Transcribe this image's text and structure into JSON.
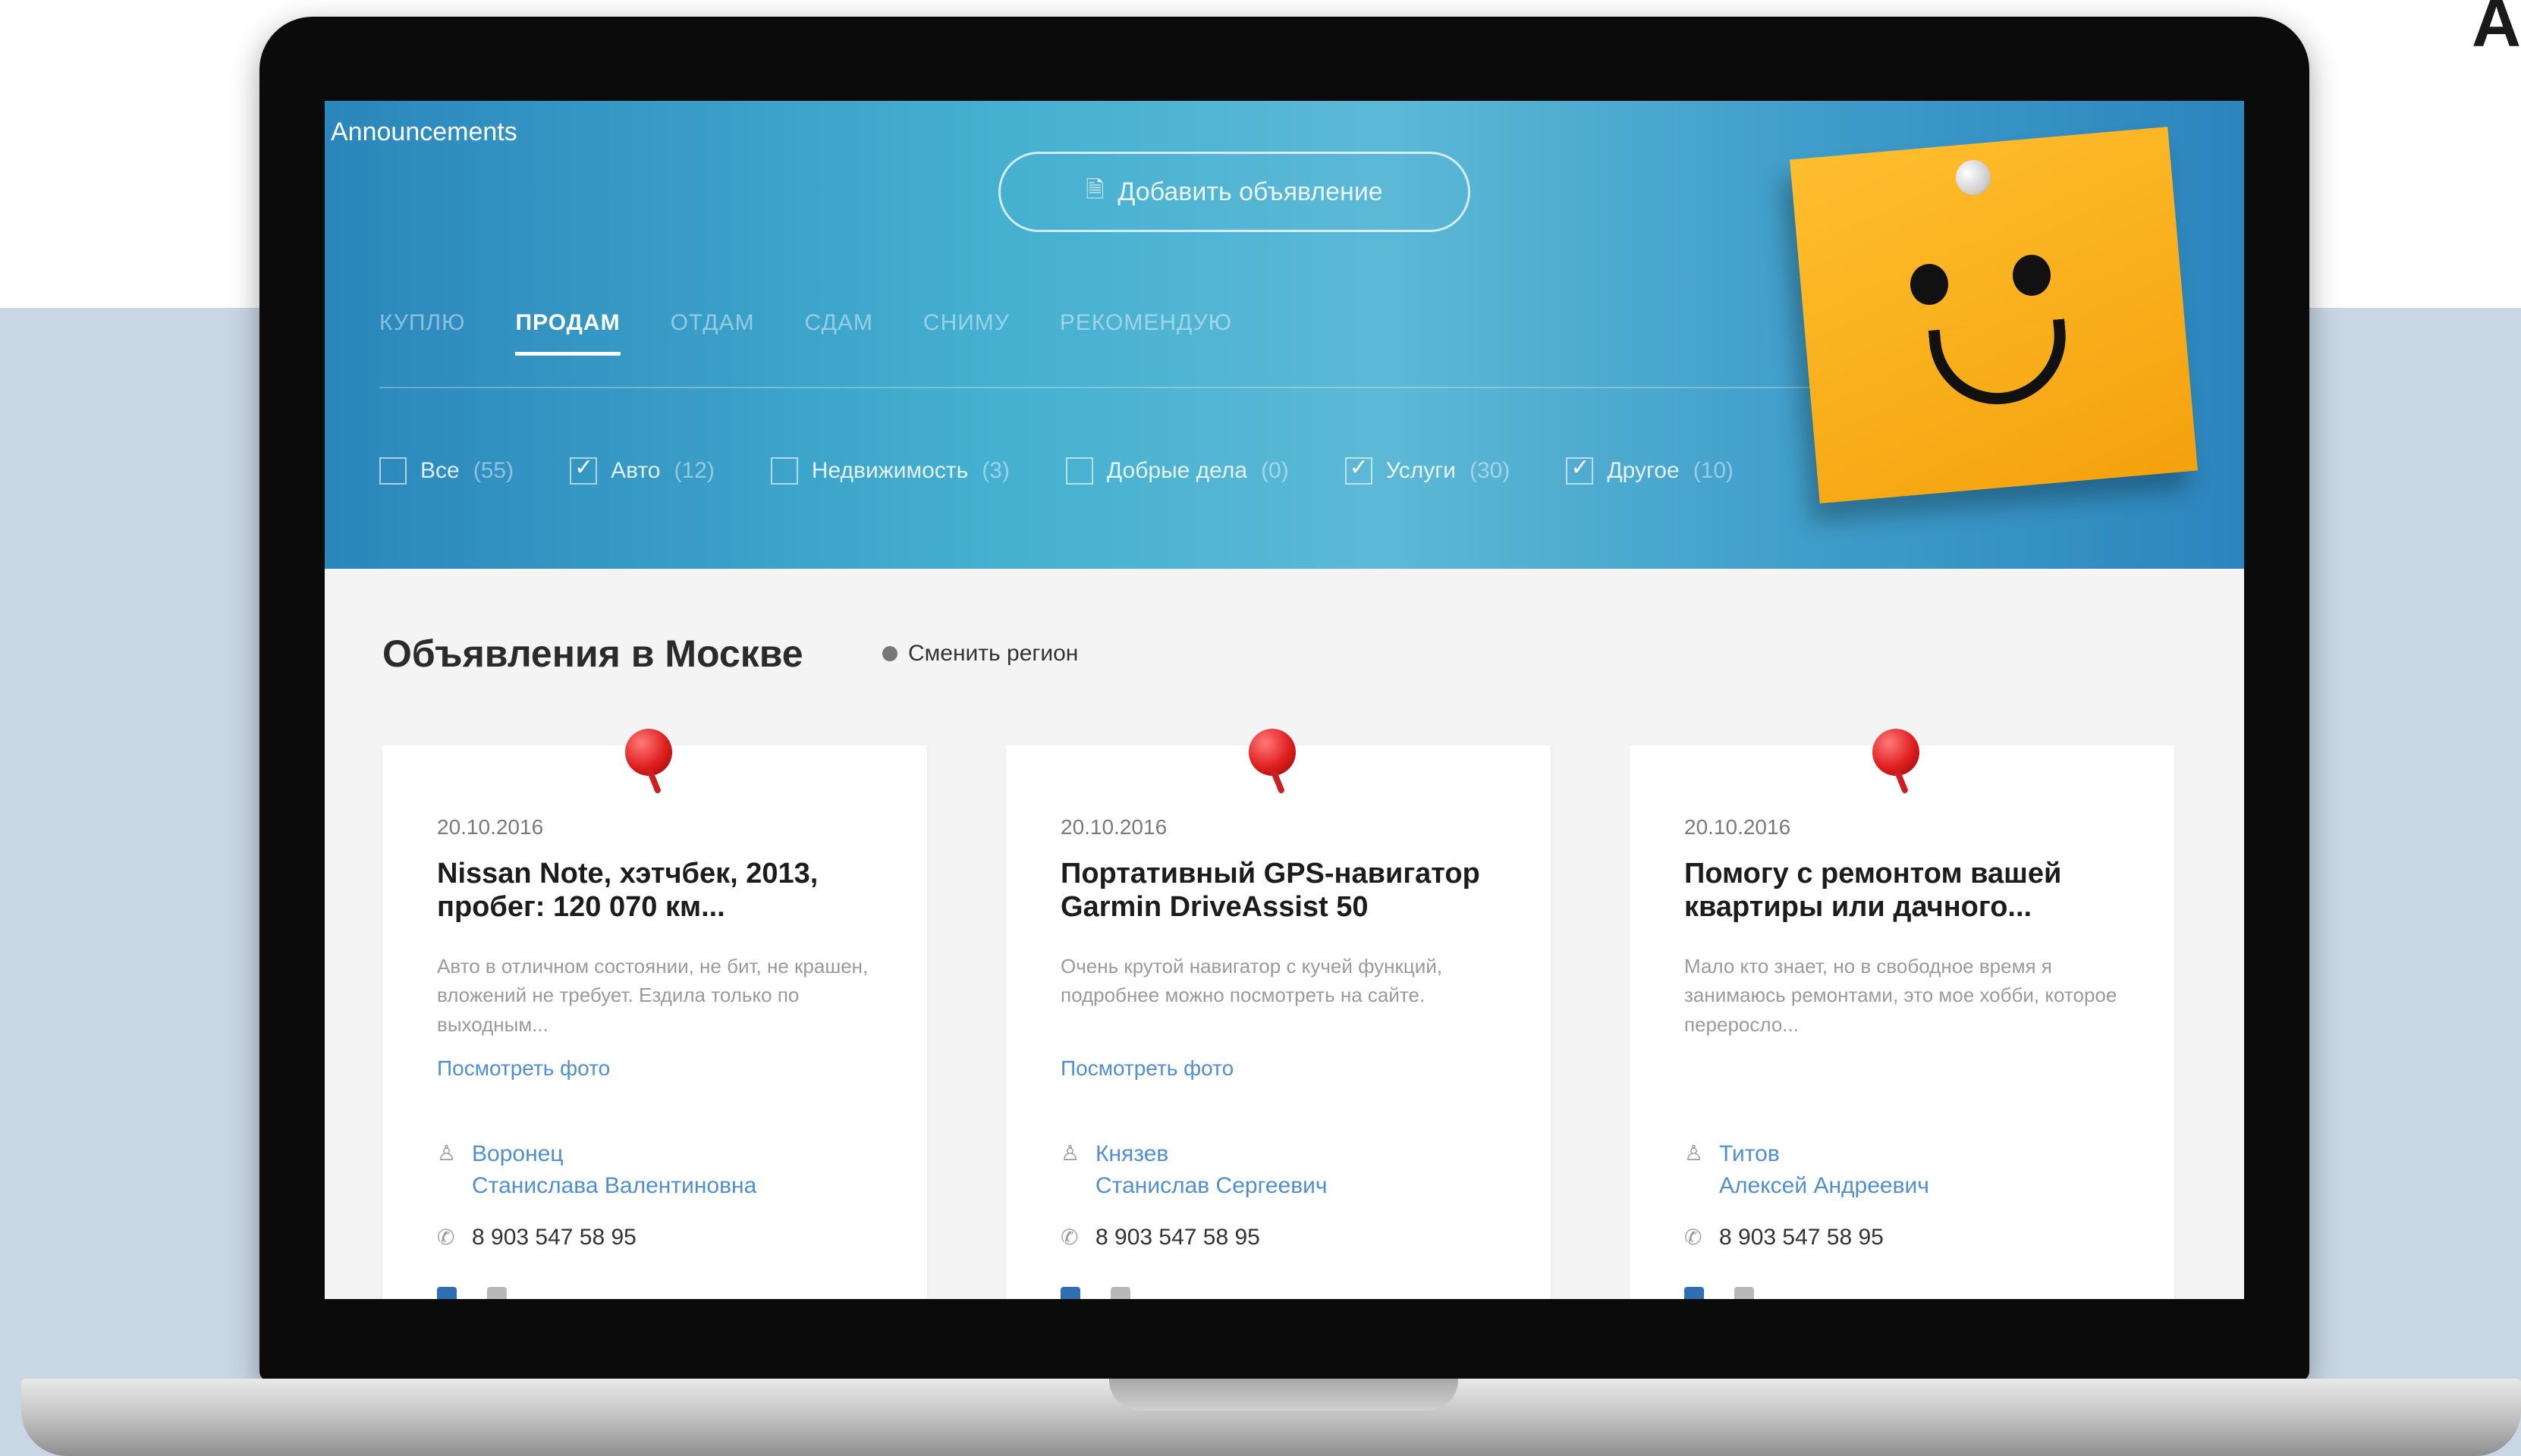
{
  "corner_text": "A",
  "window_title": "Announcements",
  "header": {
    "add_button": "Добавить объявление",
    "tabs": [
      {
        "label": "КУПЛЮ",
        "active": false
      },
      {
        "label": "ПРОДАМ",
        "active": true
      },
      {
        "label": "ОТДАМ",
        "active": false
      },
      {
        "label": "СДАМ",
        "active": false
      },
      {
        "label": "СНИМУ",
        "active": false
      },
      {
        "label": "РЕКОМЕНДУЮ",
        "active": false
      }
    ],
    "filters": [
      {
        "label": "Все",
        "count": "(55)",
        "checked": false
      },
      {
        "label": "Авто",
        "count": "(12)",
        "checked": true
      },
      {
        "label": "Недвижимость",
        "count": "(3)",
        "checked": false
      },
      {
        "label": "Добрые дела",
        "count": "(0)",
        "checked": false
      },
      {
        "label": "Услуги",
        "count": "(30)",
        "checked": true
      },
      {
        "label": "Другое",
        "count": "(10)",
        "checked": true
      }
    ]
  },
  "main": {
    "title": "Объявления в Москве",
    "change_region": "Сменить регион"
  },
  "cards": [
    {
      "date": "20.10.2016",
      "title": "Nissan Note, хэтчбек, 2013, пробег: 120 070 км...",
      "description": "Авто в отличном состоянии, не бит, не крашен, вложений не требует. Ездила только по выходным...",
      "photo_link": "Посмотреть фото",
      "author_last": "Воронец",
      "author_first": "Станислава Валентиновна",
      "phone": "8 903 547 58 95"
    },
    {
      "date": "20.10.2016",
      "title": "Портативный GPS-навигатор Garmin DriveAssist 50",
      "description": "Очень крутой навигатор с кучей функций, подробнее можно посмотреть на сайте.",
      "photo_link": "Посмотреть фото",
      "author_last": "Князев",
      "author_first": "Станислав Сергеевич",
      "phone": "8 903 547 58 95"
    },
    {
      "date": "20.10.2016",
      "title": "Помогу с ремонтом вашей квартиры или дачного...",
      "description": "Мало кто знает, но в свободное время я занимаюсь ремонтами, это мое хобби, которое переросло...",
      "photo_link": "",
      "author_last": "Титов",
      "author_first": "Алексей Андреевич",
      "phone": "8 903 547 58 95"
    }
  ],
  "icons": {
    "add": "document-icon",
    "region": "location-dot-icon",
    "author": "person-icon",
    "phone": "phone-icon",
    "sticky": "smiley-sticky-note"
  },
  "colors": {
    "header_blue": "#2a86bb",
    "header_light": "#5cb9d6",
    "link_blue": "#4f8fd0",
    "sticky_yellow": "#ffbe2e",
    "pin_red": "#e01e1e"
  }
}
